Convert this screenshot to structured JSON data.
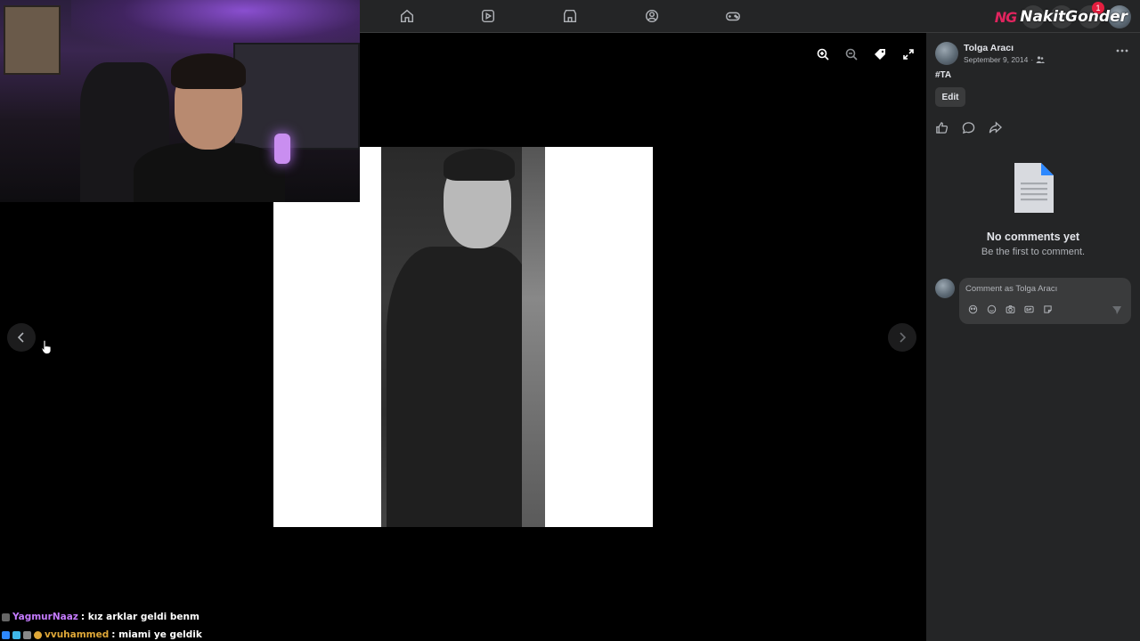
{
  "topbar": {
    "brand_mark": "NG",
    "brand_name": "NakitGonder",
    "notification_count": "1",
    "nav_icons": [
      "home-icon",
      "video-icon",
      "marketplace-icon",
      "groups-icon",
      "gaming-icon"
    ]
  },
  "viewer": {
    "tools": [
      "zoom-in-icon",
      "zoom-out-icon",
      "tag-icon",
      "fullscreen-icon"
    ]
  },
  "chat": {
    "lines": [
      {
        "user": "YagmurNaaz",
        "message": ": kız arklar geldi benm"
      },
      {
        "user": "vvuhammed",
        "message": ": miami ye geldik"
      }
    ]
  },
  "post": {
    "author": "Tolga Aracı",
    "date": "September 9, 2014",
    "separator": "·",
    "caption": "#TA",
    "edit_label": "Edit"
  },
  "comments": {
    "empty_title": "No comments yet",
    "empty_subtitle": "Be the first to comment.",
    "input_placeholder": "Comment as Tolga Aracı"
  },
  "colors": {
    "panel_bg": "#242526",
    "topbar_bg": "#242526",
    "viewer_bg": "#000000",
    "accent_blue": "#2d88ff",
    "badge_red": "#e41e3f"
  }
}
